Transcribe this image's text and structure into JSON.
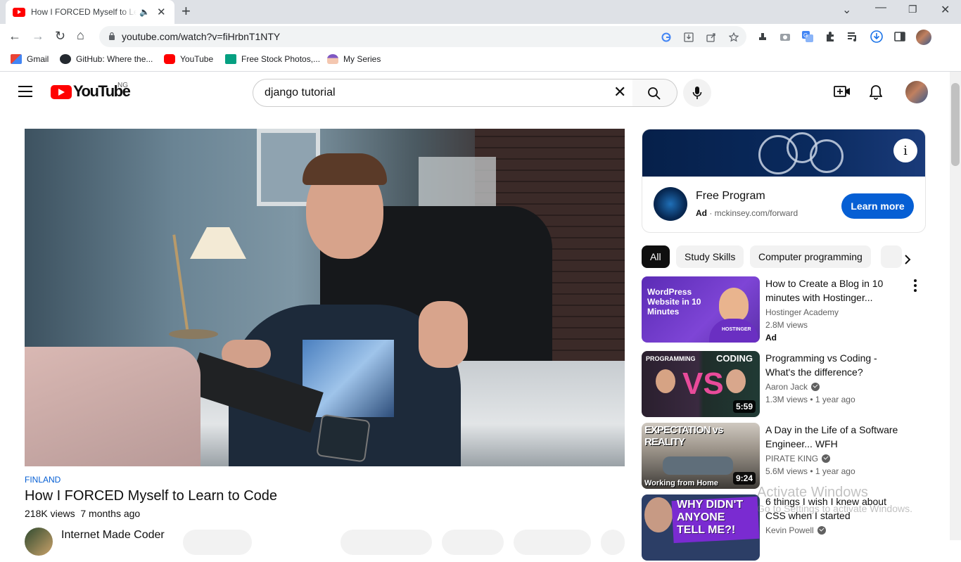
{
  "browser": {
    "tab_title": "How I FORCED Myself to Learn to Code - YouTube",
    "url": "youtube.com/watch?v=fiHrbnT1NTY",
    "bookmarks": [
      {
        "label": "Gmail",
        "icon": "gmail-icon"
      },
      {
        "label": "GitHub: Where the...",
        "icon": "github-icon"
      },
      {
        "label": "YouTube",
        "icon": "youtube-icon"
      },
      {
        "label": "Free Stock Photos,...",
        "icon": "stock-photos-icon"
      },
      {
        "label": "My Series",
        "icon": "my-series-icon"
      }
    ]
  },
  "header": {
    "logo_text": "YouTube",
    "country_code": "NG",
    "search_value": "django tutorial"
  },
  "video": {
    "hashtag": "FINLAND",
    "title": "How I FORCED Myself to Learn to Code",
    "views": "218K views",
    "age": "7 months ago",
    "channel": "Internet Made Coder"
  },
  "ad": {
    "title": "Free Program",
    "badge": "Ad",
    "domain": "mckinsey.com/forward",
    "cta": "Learn more"
  },
  "chips": [
    "All",
    "Study Skills",
    "Computer programming"
  ],
  "related": [
    {
      "title": "How to Create a Blog in 10 minutes with Hostinger...",
      "channel": "Hostinger Academy",
      "views": "2.8M views",
      "age": "",
      "duration": "",
      "ad_badge": "Ad",
      "thumb_text": [
        "WordPress",
        "Website in 10",
        "Minutes"
      ],
      "thumb_brand": "HOSTINGER",
      "verified": false
    },
    {
      "title": "Programming vs Coding - What's the difference?",
      "channel": "Aaron Jack",
      "views": "1.3M views",
      "age": "1 year ago",
      "duration": "5:59",
      "thumb_text": [
        "PROGRAMMING",
        "CODING",
        "VS"
      ],
      "verified": true
    },
    {
      "title": "A Day in the Life of a Software Engineer... WFH",
      "channel": "PIRATE KING",
      "views": "5.6M views",
      "age": "1 year ago",
      "duration": "9:24",
      "thumb_text": [
        "EXPECTATION vs REALITY",
        "Working from Home"
      ],
      "verified": true
    },
    {
      "title": "6 things I wish I knew about CSS when I started",
      "channel": "Kevin Powell",
      "views": "",
      "age": "",
      "duration": "",
      "thumb_text": [
        "WHY DIDN'T",
        "ANYONE",
        "TELL ME?!"
      ],
      "verified": true
    }
  ],
  "watermark": {
    "line1": "Activate Windows",
    "line2": "Go to Settings to activate Windows."
  }
}
